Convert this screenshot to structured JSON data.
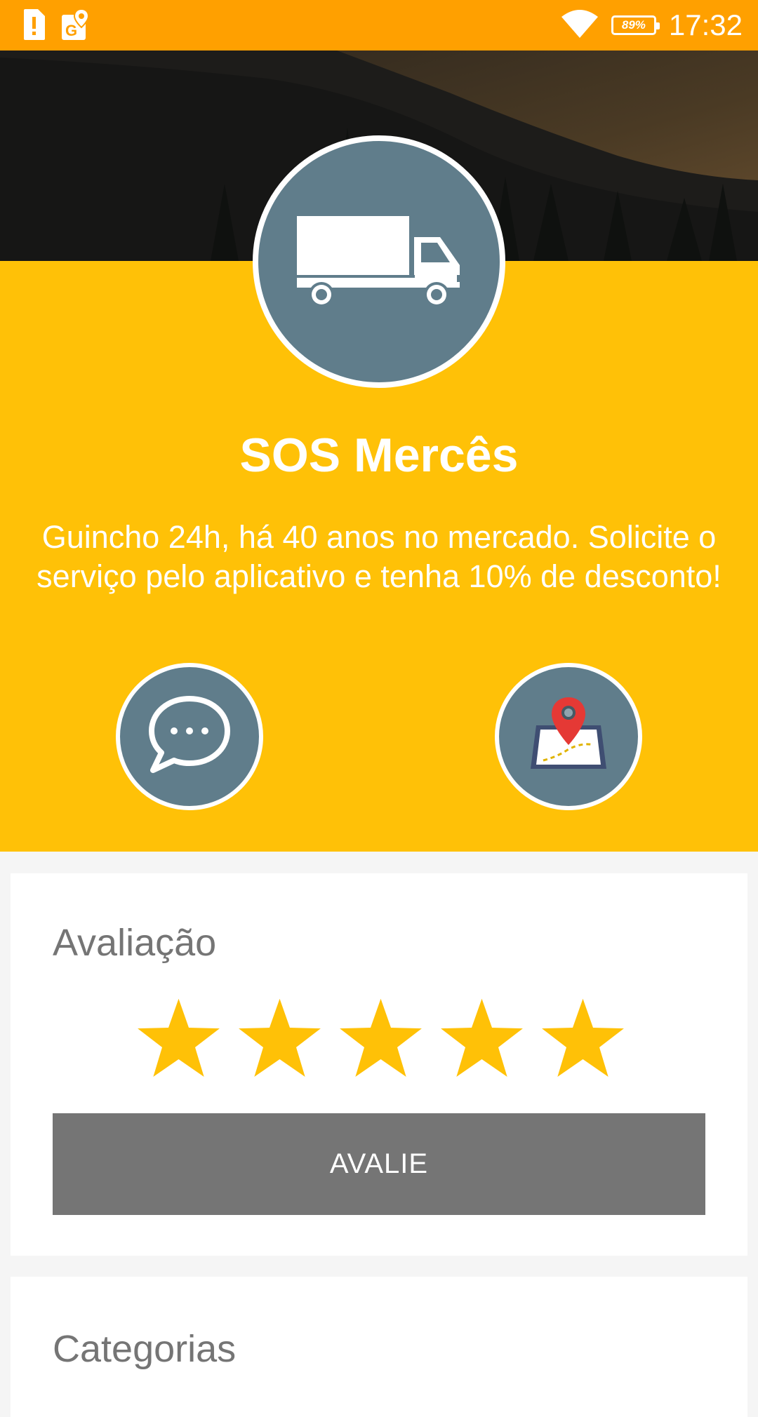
{
  "status_bar": {
    "battery_percent": "89%",
    "time": "17:32",
    "icons": [
      "alert-sim-icon",
      "maps-notification-icon",
      "wifi-icon",
      "battery-icon"
    ]
  },
  "hero": {
    "image": "dark-hillside-photo"
  },
  "company": {
    "avatar_icon": "truck-icon",
    "name": "SOS Mercês",
    "description": "Guincho 24h, há 40 anos no mercado. Solicite o serviço pelo aplicativo e tenha 10% de desconto!"
  },
  "actions": {
    "chat_icon": "chat-bubble-icon",
    "map_icon": "map-pin-icon"
  },
  "rating": {
    "title": "Avaliação",
    "stars": 5,
    "max_stars": 5,
    "button_label": "AVALIE"
  },
  "categories": {
    "title": "Categorias"
  },
  "colors": {
    "status_bar": "#ffa000",
    "accent_yellow": "#ffc107",
    "icon_circle": "#607d8b",
    "button_gray": "#757575"
  }
}
